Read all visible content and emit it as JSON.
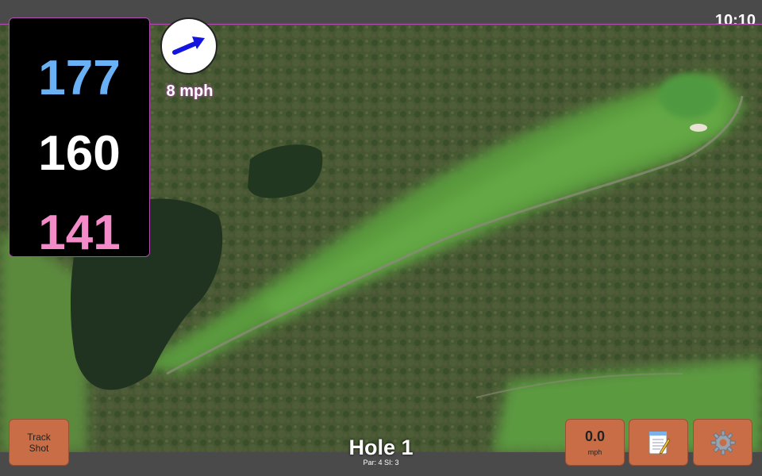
{
  "status_bar": {
    "time": "10:10"
  },
  "distances": {
    "back": "177",
    "middle": "160",
    "front": "141"
  },
  "wind": {
    "speed": "8 mph",
    "direction_icon": "wind-arrow-icon"
  },
  "hole": {
    "title": "Hole 1",
    "info": "Par: 4   SI: 3"
  },
  "buttons": {
    "track_shot": {
      "line1": "Track",
      "line2": "Shot"
    },
    "speed": {
      "value": "0.0",
      "unit": "mph"
    },
    "notes_icon": "notepad-icon",
    "settings_icon": "gear-icon"
  },
  "colors": {
    "button": "#c86d46",
    "back_distance": "#6ab0f5",
    "middle_distance": "#ffffff",
    "front_distance": "#f28bc7",
    "panel": "#000000"
  }
}
